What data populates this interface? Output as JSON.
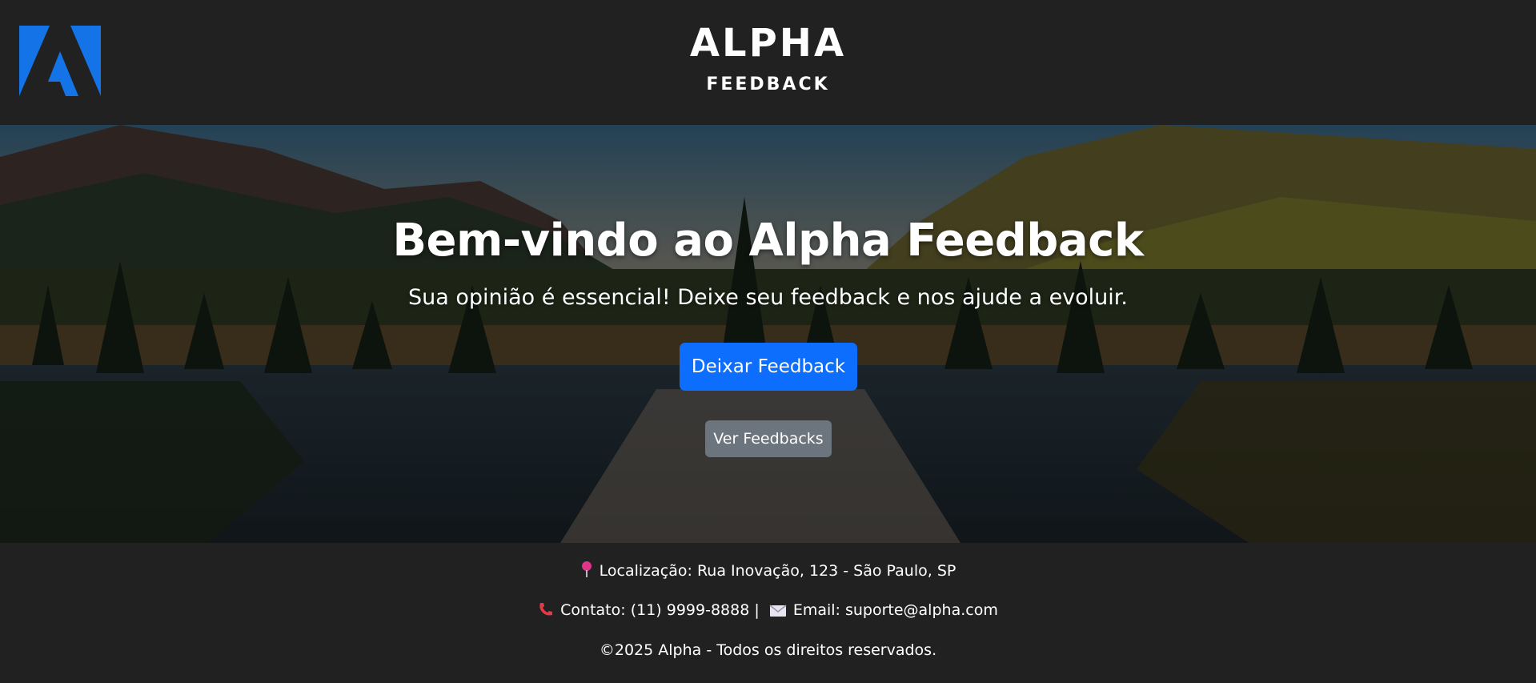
{
  "header": {
    "logo_icon": "adobe-style-a-logo",
    "title": "ALPHA",
    "subtitle": "FEEDBACK"
  },
  "hero": {
    "background": "mountain-lake-landscape",
    "title": "Bem-vindo ao Alpha Feedback",
    "subtitle": "Sua opinião é essencial! Deixe seu feedback e nos ajude a evoluir.",
    "primary_button": "Deixar Feedback",
    "secondary_button": "Ver Feedbacks"
  },
  "footer": {
    "location_icon": "pin-icon",
    "location": "Localização: Rua Inovação, 123 - São Paulo, SP",
    "phone_icon": "phone-icon",
    "contact": "Contato: (11) 9999-8888",
    "separator": "|",
    "email_icon": "envelope-icon",
    "email": "Email: suporte@alpha.com",
    "copyright": "©2025 Alpha - Todos os direitos reservados."
  },
  "colors": {
    "background": "#212121",
    "primary": "#0d6efd",
    "secondary": "#6c757d",
    "logo": "#1473e6"
  }
}
